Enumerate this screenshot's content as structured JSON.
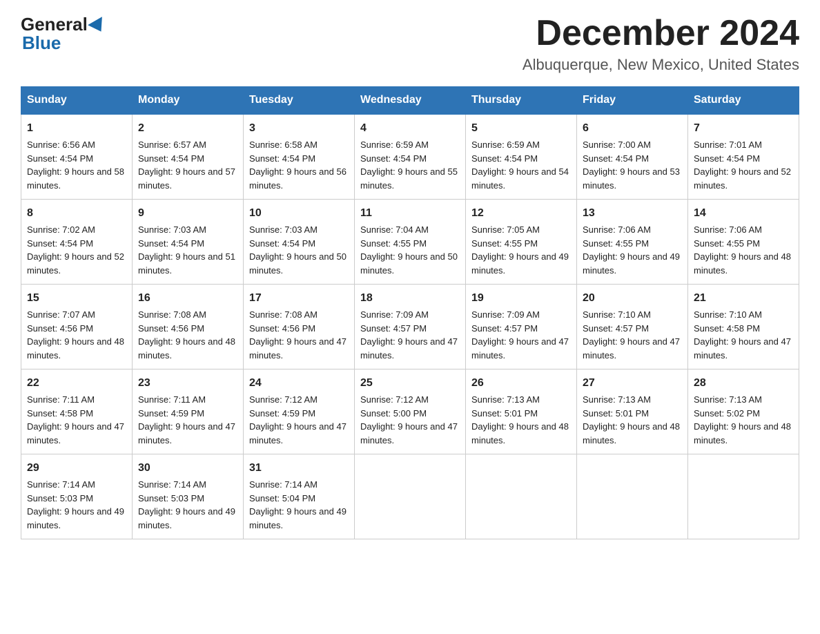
{
  "logo": {
    "general": "General",
    "blue": "Blue"
  },
  "title": "December 2024",
  "subtitle": "Albuquerque, New Mexico, United States",
  "days_of_week": [
    "Sunday",
    "Monday",
    "Tuesday",
    "Wednesday",
    "Thursday",
    "Friday",
    "Saturday"
  ],
  "weeks": [
    [
      {
        "num": "1",
        "sunrise": "6:56 AM",
        "sunset": "4:54 PM",
        "daylight": "9 hours and 58 minutes."
      },
      {
        "num": "2",
        "sunrise": "6:57 AM",
        "sunset": "4:54 PM",
        "daylight": "9 hours and 57 minutes."
      },
      {
        "num": "3",
        "sunrise": "6:58 AM",
        "sunset": "4:54 PM",
        "daylight": "9 hours and 56 minutes."
      },
      {
        "num": "4",
        "sunrise": "6:59 AM",
        "sunset": "4:54 PM",
        "daylight": "9 hours and 55 minutes."
      },
      {
        "num": "5",
        "sunrise": "6:59 AM",
        "sunset": "4:54 PM",
        "daylight": "9 hours and 54 minutes."
      },
      {
        "num": "6",
        "sunrise": "7:00 AM",
        "sunset": "4:54 PM",
        "daylight": "9 hours and 53 minutes."
      },
      {
        "num": "7",
        "sunrise": "7:01 AM",
        "sunset": "4:54 PM",
        "daylight": "9 hours and 52 minutes."
      }
    ],
    [
      {
        "num": "8",
        "sunrise": "7:02 AM",
        "sunset": "4:54 PM",
        "daylight": "9 hours and 52 minutes."
      },
      {
        "num": "9",
        "sunrise": "7:03 AM",
        "sunset": "4:54 PM",
        "daylight": "9 hours and 51 minutes."
      },
      {
        "num": "10",
        "sunrise": "7:03 AM",
        "sunset": "4:54 PM",
        "daylight": "9 hours and 50 minutes."
      },
      {
        "num": "11",
        "sunrise": "7:04 AM",
        "sunset": "4:55 PM",
        "daylight": "9 hours and 50 minutes."
      },
      {
        "num": "12",
        "sunrise": "7:05 AM",
        "sunset": "4:55 PM",
        "daylight": "9 hours and 49 minutes."
      },
      {
        "num": "13",
        "sunrise": "7:06 AM",
        "sunset": "4:55 PM",
        "daylight": "9 hours and 49 minutes."
      },
      {
        "num": "14",
        "sunrise": "7:06 AM",
        "sunset": "4:55 PM",
        "daylight": "9 hours and 48 minutes."
      }
    ],
    [
      {
        "num": "15",
        "sunrise": "7:07 AM",
        "sunset": "4:56 PM",
        "daylight": "9 hours and 48 minutes."
      },
      {
        "num": "16",
        "sunrise": "7:08 AM",
        "sunset": "4:56 PM",
        "daylight": "9 hours and 48 minutes."
      },
      {
        "num": "17",
        "sunrise": "7:08 AM",
        "sunset": "4:56 PM",
        "daylight": "9 hours and 47 minutes."
      },
      {
        "num": "18",
        "sunrise": "7:09 AM",
        "sunset": "4:57 PM",
        "daylight": "9 hours and 47 minutes."
      },
      {
        "num": "19",
        "sunrise": "7:09 AM",
        "sunset": "4:57 PM",
        "daylight": "9 hours and 47 minutes."
      },
      {
        "num": "20",
        "sunrise": "7:10 AM",
        "sunset": "4:57 PM",
        "daylight": "9 hours and 47 minutes."
      },
      {
        "num": "21",
        "sunrise": "7:10 AM",
        "sunset": "4:58 PM",
        "daylight": "9 hours and 47 minutes."
      }
    ],
    [
      {
        "num": "22",
        "sunrise": "7:11 AM",
        "sunset": "4:58 PM",
        "daylight": "9 hours and 47 minutes."
      },
      {
        "num": "23",
        "sunrise": "7:11 AM",
        "sunset": "4:59 PM",
        "daylight": "9 hours and 47 minutes."
      },
      {
        "num": "24",
        "sunrise": "7:12 AM",
        "sunset": "4:59 PM",
        "daylight": "9 hours and 47 minutes."
      },
      {
        "num": "25",
        "sunrise": "7:12 AM",
        "sunset": "5:00 PM",
        "daylight": "9 hours and 47 minutes."
      },
      {
        "num": "26",
        "sunrise": "7:13 AM",
        "sunset": "5:01 PM",
        "daylight": "9 hours and 48 minutes."
      },
      {
        "num": "27",
        "sunrise": "7:13 AM",
        "sunset": "5:01 PM",
        "daylight": "9 hours and 48 minutes."
      },
      {
        "num": "28",
        "sunrise": "7:13 AM",
        "sunset": "5:02 PM",
        "daylight": "9 hours and 48 minutes."
      }
    ],
    [
      {
        "num": "29",
        "sunrise": "7:14 AM",
        "sunset": "5:03 PM",
        "daylight": "9 hours and 49 minutes."
      },
      {
        "num": "30",
        "sunrise": "7:14 AM",
        "sunset": "5:03 PM",
        "daylight": "9 hours and 49 minutes."
      },
      {
        "num": "31",
        "sunrise": "7:14 AM",
        "sunset": "5:04 PM",
        "daylight": "9 hours and 49 minutes."
      },
      null,
      null,
      null,
      null
    ]
  ]
}
